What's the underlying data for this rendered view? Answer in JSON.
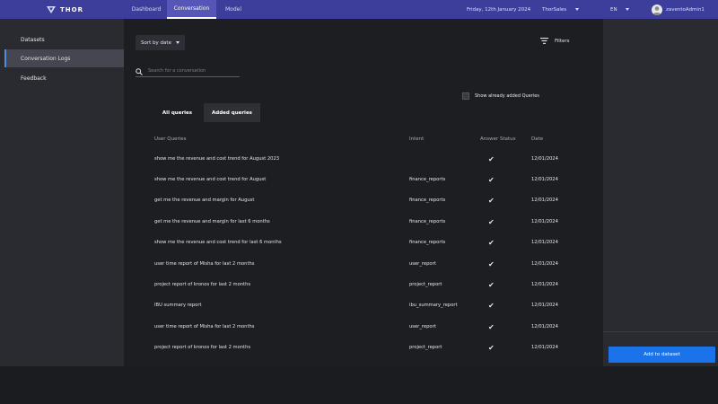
{
  "app": {
    "brand": "THOR"
  },
  "nav": {
    "tabs": [
      {
        "label": "Dashboard",
        "active": false
      },
      {
        "label": "Conversation",
        "active": true
      },
      {
        "label": "Model",
        "active": false
      }
    ],
    "date": "Friday, 12th January 2024",
    "workspace": "ThorSales",
    "language": "EN",
    "user": "zaventoAdmin1"
  },
  "sidebar": {
    "items": [
      {
        "label": "Datasets",
        "active": false
      },
      {
        "label": "Conversation Logs",
        "active": true
      },
      {
        "label": "Feedback",
        "active": false
      }
    ]
  },
  "toolbar": {
    "sort_label": "Sort by date",
    "filters_label": "Filters",
    "search_placeholder": "Search for a conversation",
    "show_added_label": "Show already added Queries",
    "show_added_checked": false
  },
  "segments": {
    "all": "All queries",
    "added": "Added queries",
    "active": "added"
  },
  "table": {
    "headers": {
      "query": "User Queries",
      "intent": "Intent",
      "status": "Answer Status",
      "date": "Date"
    },
    "rows": [
      {
        "query": "show me the revenue and cost trend for August 2023",
        "intent": "",
        "status": "✔",
        "date": "12/01/2024"
      },
      {
        "query": "show me the revenue and cost trend for August",
        "intent": "finance_reports",
        "status": "✔",
        "date": "12/01/2024"
      },
      {
        "query": "get me the revenue and margin for August",
        "intent": "finance_reports",
        "status": "✔",
        "date": "12/01/2024"
      },
      {
        "query": "get me the revenue and margin for last 6 months",
        "intent": "finance_reports",
        "status": "✔",
        "date": "12/01/2024"
      },
      {
        "query": "show me the revenue and cost trend for last 6 months",
        "intent": "finance_reports",
        "status": "✔",
        "date": "12/01/2024"
      },
      {
        "query": "user time report of Misha for last 2 months",
        "intent": "user_report",
        "status": "✔",
        "date": "12/01/2024"
      },
      {
        "query": "project report of kronos for last 2 months",
        "intent": "project_report",
        "status": "✔",
        "date": "12/01/2024"
      },
      {
        "query": "IBU summary report",
        "intent": "ibu_summary_report",
        "status": "✔",
        "date": "12/01/2024"
      },
      {
        "query": "user time report of Misha for last 2 months",
        "intent": "user_report",
        "status": "✔",
        "date": "12/01/2024"
      },
      {
        "query": "project report of kronos for last 2 months",
        "intent": "project_report",
        "status": "✔",
        "date": "12/01/2024"
      }
    ]
  },
  "actions": {
    "add_to_dataset": "Add to dataset"
  },
  "colors": {
    "nav_bg": "#3d3d9c",
    "nav_active": "#5656b8",
    "primary_button": "#1a73e8",
    "sidebar_active_accent": "#4a8fe0"
  }
}
